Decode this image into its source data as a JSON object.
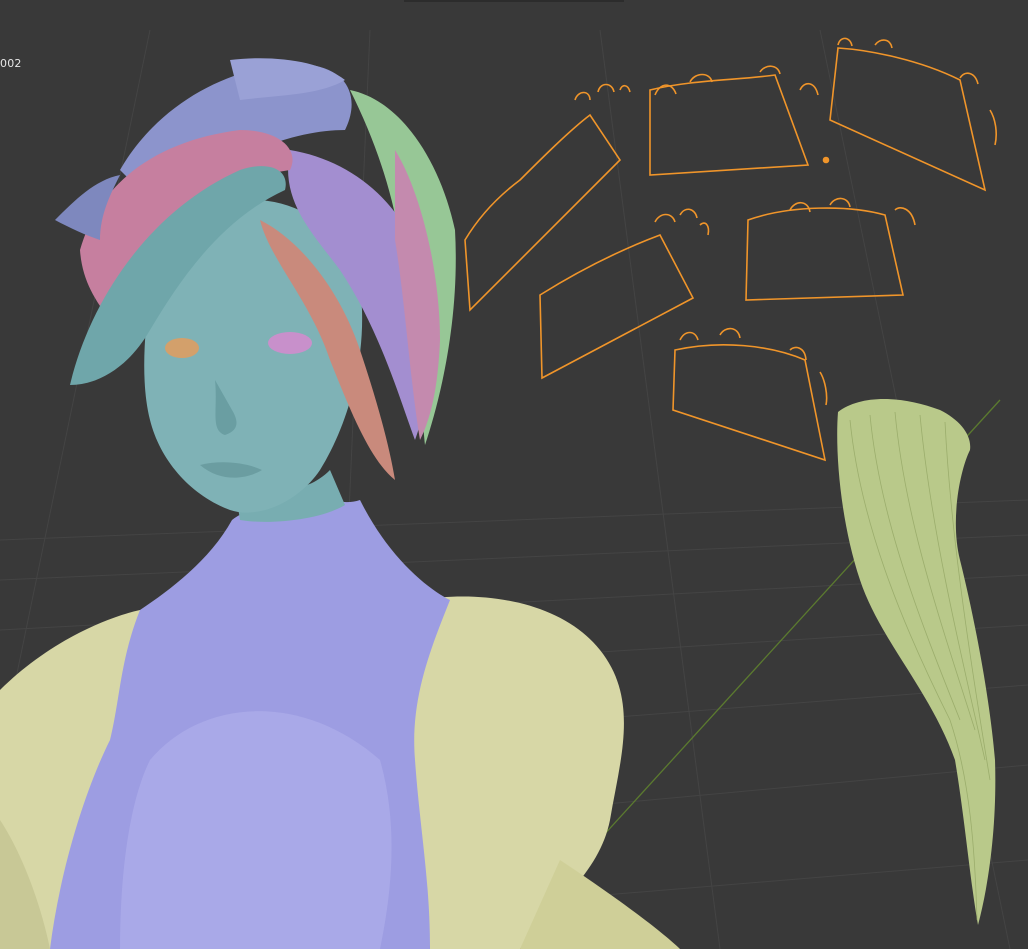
{
  "viewport": {
    "object_label": "002",
    "background": "#393939",
    "grid_color": "#454545",
    "axis_color": "#5b7a2f",
    "selection_color": "#f0952a"
  },
  "materials": {
    "skin_teal": "#7fb1b4",
    "top_purple": "#9c9ce0",
    "body_yellow": "#d9d9a9",
    "hair_blue": "#8c94cc",
    "hair_pink": "#c67f9f",
    "hair_teal": "#6fa6aa",
    "hair_violet": "#a38ed0",
    "hair_salmon": "#c98a7c",
    "hair_green": "#97c796",
    "hair_lime": "#b7c788",
    "eye_pink": "#c98fca",
    "eye_orange": "#d2a06a"
  },
  "objects": [
    {
      "name": "character-body",
      "selected": false
    },
    {
      "name": "hair-cards",
      "selected": false
    },
    {
      "name": "hair-curve-guides",
      "selected": true,
      "count": 6
    },
    {
      "name": "hair-strand-clump",
      "selected": false
    }
  ]
}
